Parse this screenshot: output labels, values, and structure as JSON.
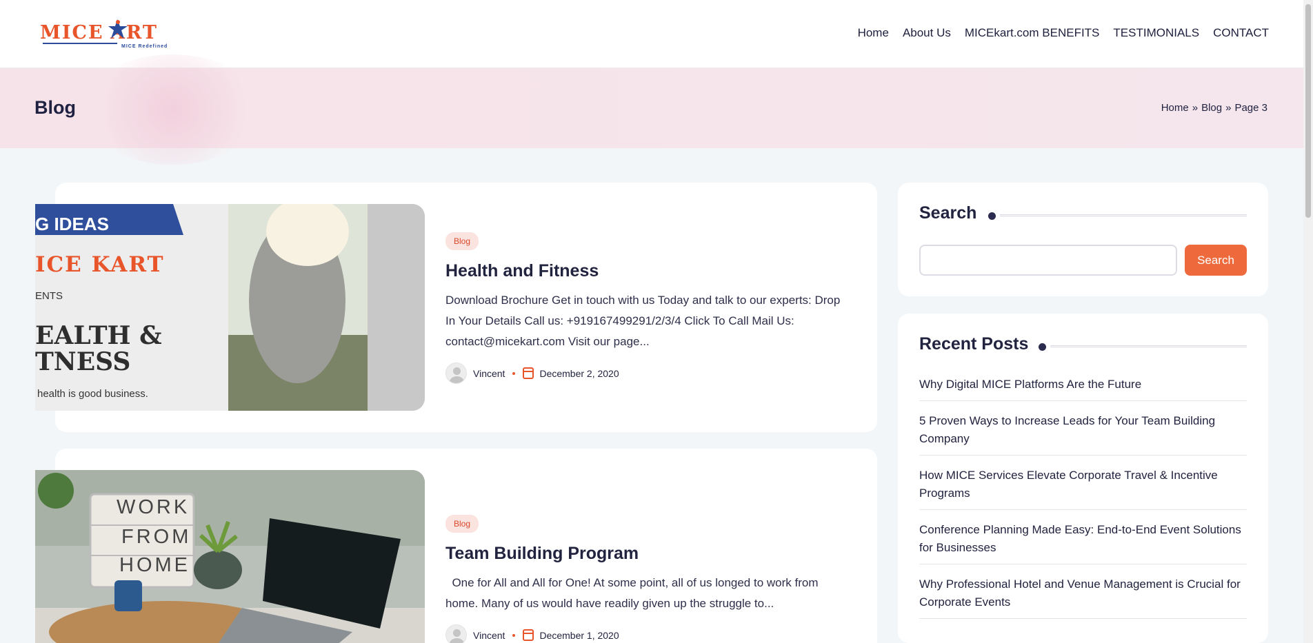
{
  "header": {
    "logo": {
      "text": "MICE KART",
      "tagline": "MICE Redefined"
    },
    "nav": [
      "Home",
      "About Us",
      "MICEkart.com BENEFITS",
      "TESTIMONIALS",
      "CONTACT"
    ]
  },
  "page": {
    "title": "Blog",
    "breadcrumb": {
      "home": "Home",
      "sep": "»",
      "blog": "Blog",
      "current": "Page 3"
    }
  },
  "posts": [
    {
      "category": "Blog",
      "title": "Health and Fitness",
      "excerpt": "Download Brochure Get in touch with us Today and talk to our experts: Drop In Your Details   Call us: +919167499291/2/3/4 Click To Call Mail Us: contact@micekart.com Visit our page...",
      "author": "Vincent",
      "date": "December 2, 2020",
      "image": {
        "banner": "G IDEAS",
        "logo": "ICE KART",
        "small": "ENTS",
        "heading1": "EALTH &",
        "heading2": "TNESS",
        "caption": "health is good business."
      }
    },
    {
      "category": "Blog",
      "title": "Team Building Program",
      "excerpt": "  One for All and All for One! At some point, all of us longed to work from home. Many of us would have readily given up the struggle to...",
      "author": "Vincent",
      "date": "December 1, 2020",
      "image": {
        "sign1": "WORK",
        "sign2": "FROM",
        "sign3": "HOME"
      }
    }
  ],
  "sidebar": {
    "search": {
      "title": "Search",
      "placeholder": "",
      "button": "Search"
    },
    "recent": {
      "title": "Recent Posts",
      "items": [
        "Why Digital MICE Platforms Are the Future",
        "5 Proven Ways to Increase Leads for Your Team Building Company",
        "How MICE Services Elevate Corporate Travel & Incentive Programs",
        "Conference Planning Made Easy: End-to-End Event Solutions for Businesses",
        "Why Professional Hotel and Venue Management is Crucial for Corporate Events"
      ]
    }
  },
  "colors": {
    "accent": "#ee6a3c",
    "navy": "#22233f",
    "band": "#f6e3ea"
  }
}
